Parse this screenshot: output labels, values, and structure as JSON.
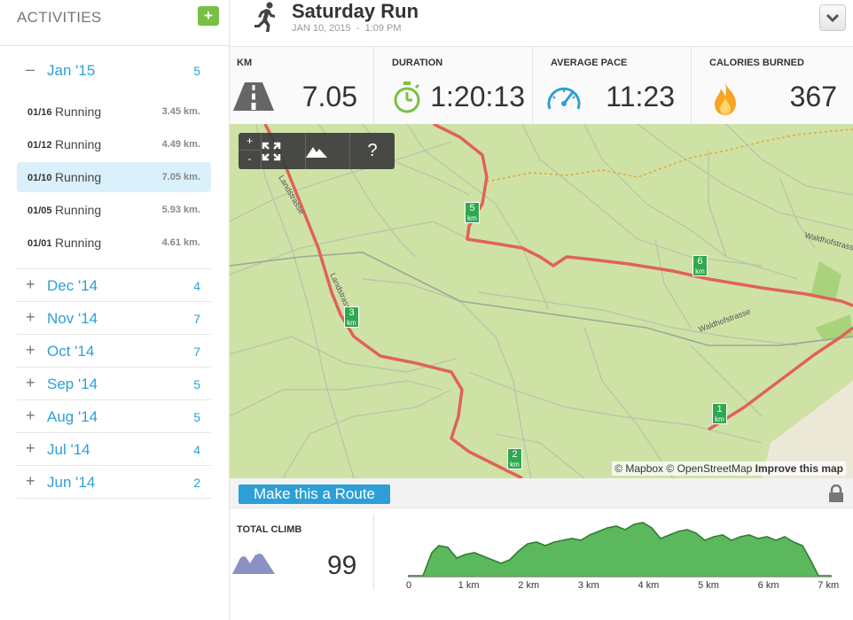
{
  "sidebar": {
    "title": "ACTIVITIES",
    "add_label": "+",
    "open_month": {
      "toggle": "–",
      "label": "Jan '15",
      "count": "5"
    },
    "activities": [
      {
        "date": "01/16",
        "name": "Running",
        "distance": "3.45 km.",
        "active": false
      },
      {
        "date": "01/12",
        "name": "Running",
        "distance": "4.49 km.",
        "active": false
      },
      {
        "date": "01/10",
        "name": "Running",
        "distance": "7.05 km.",
        "active": true
      },
      {
        "date": "01/05",
        "name": "Running",
        "distance": "5.93 km.",
        "active": false
      },
      {
        "date": "01/01",
        "name": "Running",
        "distance": "4.61 km.",
        "active": false
      }
    ],
    "months": [
      {
        "toggle": "+",
        "label": "Dec '14",
        "count": "4"
      },
      {
        "toggle": "+",
        "label": "Nov '14",
        "count": "7"
      },
      {
        "toggle": "+",
        "label": "Oct '14",
        "count": "7"
      },
      {
        "toggle": "+",
        "label": "Sep '14",
        "count": "5"
      },
      {
        "toggle": "+",
        "label": "Aug '14",
        "count": "5"
      },
      {
        "toggle": "+",
        "label": "Jul '14",
        "count": "4"
      },
      {
        "toggle": "+",
        "label": "Jun '14",
        "count": "2"
      }
    ]
  },
  "header": {
    "icon": "runner-icon",
    "title": "Saturday Run",
    "date": "JAN 10, 2015",
    "separator": "-",
    "time": "1:09 PM",
    "dropdown_icon": "chevron-down-icon"
  },
  "stats": {
    "km": {
      "label": "KM",
      "value": "7.05",
      "icon": "road-icon"
    },
    "duration": {
      "label": "DURATION",
      "value": "1:20:13",
      "icon": "stopwatch-icon"
    },
    "pace": {
      "label": "AVERAGE PACE",
      "value": "11:23",
      "icon": "speedometer-icon"
    },
    "calories": {
      "label": "CALORIES BURNED",
      "value": "367",
      "icon": "flame-icon"
    }
  },
  "map": {
    "zoom_in": "+",
    "zoom_out": "-",
    "help": "?",
    "street_labels": [
      "Landstrasse",
      "Landstrasse",
      "Waldhofstrasse",
      "Waldhofstrasse"
    ],
    "km_markers": [
      "1",
      "2",
      "3",
      "5",
      "6"
    ],
    "km_unit": "km",
    "attribution": {
      "mapbox": "© Mapbox",
      "osm": "© OpenStreetMap",
      "improve": "Improve this map"
    },
    "colors": {
      "route": "#e0625a",
      "land": "#cfe2a6",
      "marker": "#2fa84f"
    }
  },
  "route_bar": {
    "button_label": "Make this a Route",
    "lock_icon": "lock-icon"
  },
  "climb": {
    "label": "TOTAL CLIMB",
    "value": "99",
    "icon": "mountains-icon",
    "x_ticks": [
      "0",
      "1 km",
      "2 km",
      "3 km",
      "4 km",
      "5 km",
      "6 km",
      "7 km"
    ],
    "color": "#5cb85c"
  }
}
